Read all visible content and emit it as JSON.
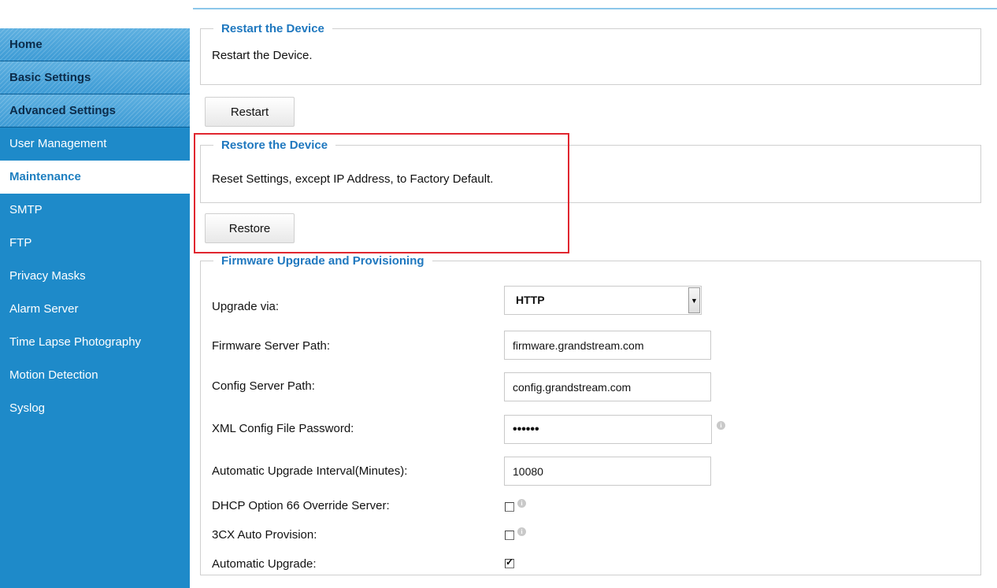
{
  "sidebar": {
    "items": [
      {
        "label": "Home",
        "type": "category"
      },
      {
        "label": "Basic Settings",
        "type": "category"
      },
      {
        "label": "Advanced Settings",
        "type": "category"
      },
      {
        "label": "User Management",
        "type": "item"
      },
      {
        "label": "Maintenance",
        "type": "active"
      },
      {
        "label": "SMTP",
        "type": "item"
      },
      {
        "label": "FTP",
        "type": "item"
      },
      {
        "label": "Privacy Masks",
        "type": "item"
      },
      {
        "label": "Alarm Server",
        "type": "item"
      },
      {
        "label": "Time Lapse Photography",
        "type": "item"
      },
      {
        "label": "Motion Detection",
        "type": "item"
      },
      {
        "label": "Syslog",
        "type": "item"
      }
    ]
  },
  "restart": {
    "legend": "Restart the Device",
    "text": "Restart the Device.",
    "button": "Restart"
  },
  "restore": {
    "legend": "Restore the Device",
    "text": "Reset Settings, except IP Address, to Factory Default.",
    "button": "Restore"
  },
  "firmware": {
    "legend": "Firmware Upgrade and Provisioning",
    "upgrade_via_label": "Upgrade via:",
    "upgrade_via_value": "HTTP",
    "firmware_path_label": "Firmware Server Path:",
    "firmware_path_value": "firmware.grandstream.com",
    "config_path_label": "Config Server Path:",
    "config_path_value": "config.grandstream.com",
    "xml_password_label": "XML Config File Password:",
    "xml_password_value": "••••••",
    "interval_label": "Automatic Upgrade Interval(Minutes):",
    "interval_value": "10080",
    "dhcp66_label": "DHCP Option 66 Override Server:",
    "dhcp66_checked": false,
    "cx3_label": "3CX Auto Provision:",
    "cx3_checked": false,
    "auto_upgrade_label": "Automatic Upgrade:",
    "auto_upgrade_checked": true
  },
  "colors": {
    "sidebar_bg": "#1e8ac9",
    "legend_blue": "#1f78bf",
    "highlight_red": "#e0262f"
  }
}
